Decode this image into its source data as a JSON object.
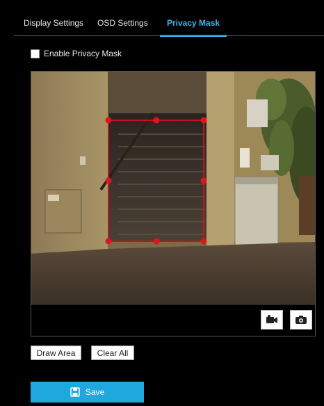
{
  "tabs": [
    {
      "label": "Display Settings"
    },
    {
      "label": "OSD Settings"
    },
    {
      "label": "Privacy Mask"
    }
  ],
  "active_tab": "Privacy Mask",
  "enable_privacy_mask": {
    "label": "Enable Privacy Mask",
    "checked": false
  },
  "video_controls": {
    "record_icon": "video-record-icon",
    "snapshot_icon": "camera-snapshot-icon"
  },
  "buttons": {
    "draw_area": "Draw Area",
    "clear_all": "Clear All",
    "save": "Save"
  },
  "colors": {
    "accent": "#3db6f2",
    "save_button": "#1ea8de",
    "mask_border": "#c0141e",
    "mask_handle": "#e0141e"
  }
}
